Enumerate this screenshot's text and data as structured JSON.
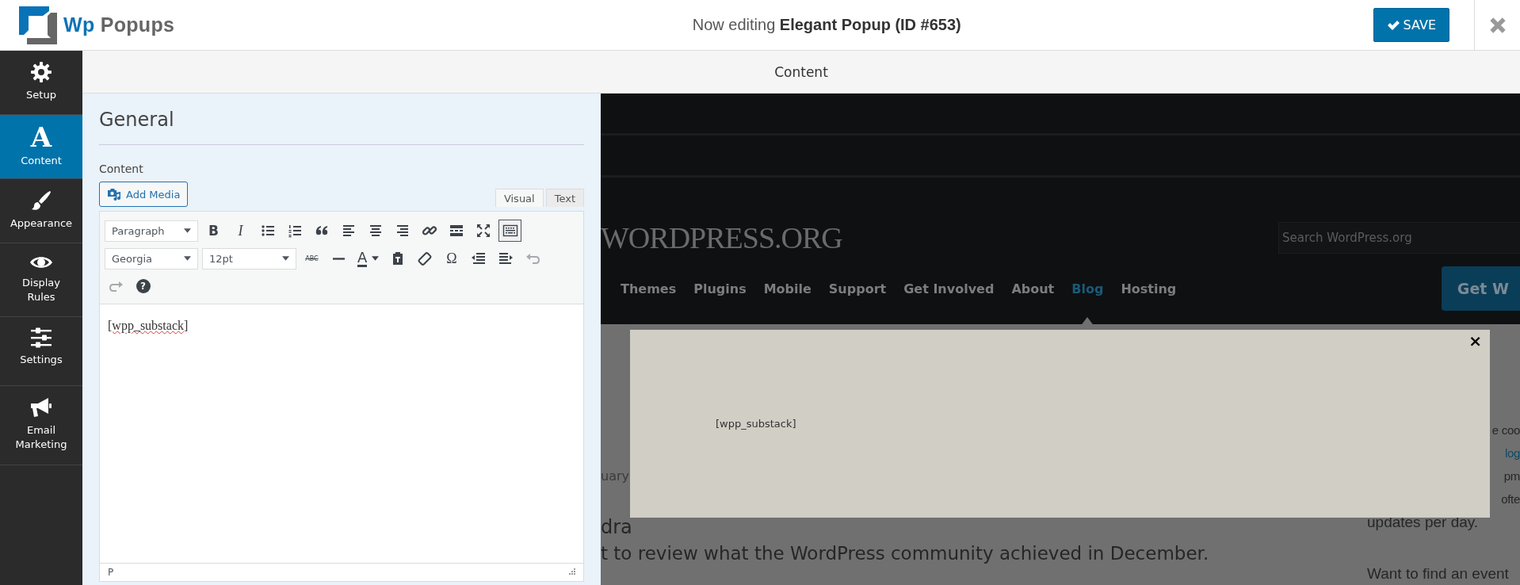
{
  "header": {
    "brand": [
      "Wp",
      "Popups"
    ],
    "title": "Now editing **Elegant Popup (ID #653)**",
    "save_button": "SAVE"
  },
  "sidebar": {
    "items": [
      {
        "label": "Setup",
        "kind": "gear",
        "selected": false
      },
      {
        "label": "Content",
        "kind": "letter",
        "glyph": "A",
        "selected": true
      },
      {
        "label": "Appearance",
        "kind": "brush",
        "selected": false
      },
      {
        "label": "Display Rules",
        "kind": "eye",
        "selected": false
      },
      {
        "label": "Settings",
        "kind": "sliders",
        "selected": false
      },
      {
        "label": "Email Marketing",
        "kind": "megaphone",
        "selected": false
      }
    ]
  },
  "section_bar": {
    "title": "Content"
  },
  "panel": {
    "heading": "General",
    "field_label": "Content",
    "add_media": "Add Media",
    "editor_tabs": [
      {
        "label": "Visual",
        "selected": true
      },
      {
        "label": "Text",
        "selected": false
      }
    ],
    "toolbar_rows": [
      [
        {
          "kind": "select",
          "text": "Paragraph"
        },
        {
          "kind": "bold",
          "text": "B",
          "active": false,
          "disabled": false
        },
        {
          "kind": "italic",
          "text": "I",
          "active": false,
          "disabled": false
        },
        {
          "kind": "bullets",
          "active": false,
          "disabled": false
        },
        {
          "kind": "numbers",
          "active": false,
          "disabled": false
        },
        {
          "kind": "quote",
          "active": false,
          "disabled": false
        },
        {
          "kind": "align-left",
          "active": false,
          "disabled": false
        },
        {
          "kind": "align-center",
          "active": false,
          "disabled": false
        },
        {
          "kind": "align-right",
          "active": false,
          "disabled": false
        },
        {
          "kind": "link",
          "active": false,
          "disabled": false
        },
        {
          "kind": "more",
          "active": false,
          "disabled": false
        },
        {
          "kind": "fullscreen",
          "active": false,
          "disabled": false
        },
        {
          "kind": "toggle",
          "active": true,
          "disabled": false
        }
      ],
      [
        {
          "kind": "select",
          "text": "Georgia"
        },
        {
          "kind": "select",
          "text": "12pt"
        },
        {
          "kind": "strike",
          "text": "ABC",
          "active": false,
          "disabled": false
        },
        {
          "kind": "hr",
          "active": false,
          "disabled": false
        },
        {
          "kind": "text-color",
          "text": "A",
          "active": false,
          "disabled": false
        },
        {
          "kind": "paste",
          "active": false,
          "disabled": false
        },
        {
          "kind": "eraser",
          "active": false,
          "disabled": false
        },
        {
          "kind": "symbol",
          "text": "Ω",
          "active": false,
          "disabled": false
        },
        {
          "kind": "outdent",
          "active": false,
          "disabled": false
        },
        {
          "kind": "indent",
          "active": false,
          "disabled": false
        },
        {
          "kind": "undo",
          "active": false,
          "disabled": true
        }
      ],
      [
        {
          "kind": "redo",
          "active": false,
          "disabled": true
        },
        {
          "kind": "help",
          "text": "?",
          "active": false,
          "disabled": false
        }
      ]
    ],
    "body_text": "[wpp_substack]",
    "path": "P"
  },
  "preview": {
    "site_logo": "WORDPRESS.ORG",
    "search": {
      "placeholder": "Search WordPress.org"
    },
    "nav": [
      {
        "label": "Themes",
        "selected": false
      },
      {
        "label": "Plugins",
        "selected": false
      },
      {
        "label": "Mobile",
        "selected": false
      },
      {
        "label": "Support",
        "selected": false
      },
      {
        "label": "Get Involved",
        "selected": false
      },
      {
        "label": "About",
        "selected": false
      },
      {
        "label": "Blog",
        "selected": true
      },
      {
        "label": "Hosting",
        "selected": false
      }
    ],
    "cta_button": "Get W",
    "main_fragments": {
      "date": "uary",
      "lead": "dra",
      "sentence": "t to review what the WordPress community achieved in December."
    },
    "cut_lines": [
      {
        "text": "e coo",
        "link": false
      },
      {
        "text": "log",
        "link": true
      },
      {
        "text": "pm",
        "link": false
      },
      {
        "text": "ofte",
        "link": false
      }
    ],
    "lines": [
      "updates per day.",
      "Want to find an event"
    ],
    "popup": {
      "text": "[wpp_substack]",
      "close": "×"
    }
  }
}
